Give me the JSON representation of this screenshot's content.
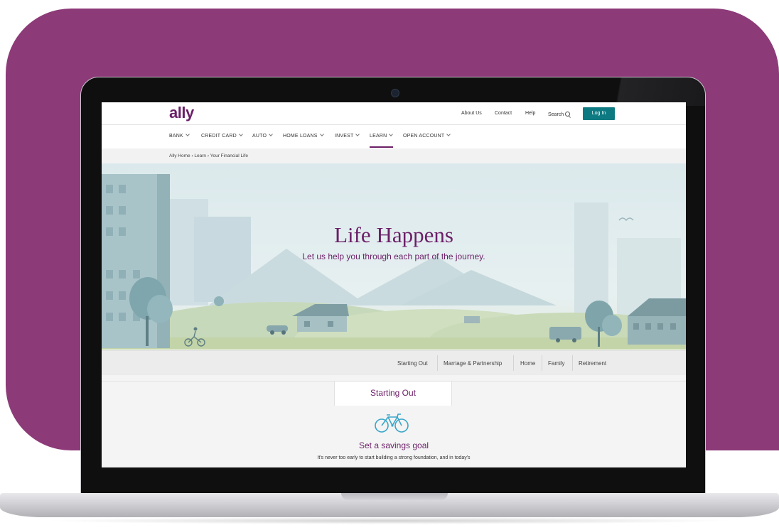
{
  "brand": {
    "logo_text": "ally",
    "primary_color": "#6b1f67",
    "accent_color": "#0d7a82",
    "frame_color": "#8c3a78"
  },
  "header": {
    "utility_links": [
      "About Us",
      "Contact",
      "Help"
    ],
    "search_label": "Search",
    "login_label": "Log In"
  },
  "nav": {
    "items": [
      "BANK",
      "CREDIT CARD",
      "AUTO",
      "HOME LOANS",
      "INVEST",
      "LEARN",
      "OPEN ACCOUNT"
    ],
    "active": "LEARN"
  },
  "breadcrumb": {
    "home": "Ally Home",
    "learn": "Learn",
    "current": "Your Financial Life"
  },
  "hero": {
    "title": "Life Happens",
    "subtitle": "Let us help you through each part of the journey."
  },
  "life_tabs": [
    "Starting Out",
    "Marriage & Partnership",
    "Home",
    "Family",
    "Retirement"
  ],
  "panel": {
    "tab_label": "Starting Out",
    "icon": "bicycle-icon",
    "heading": "Set a savings goal",
    "text": "It's never too early to start building a strong foundation, and in today's"
  }
}
